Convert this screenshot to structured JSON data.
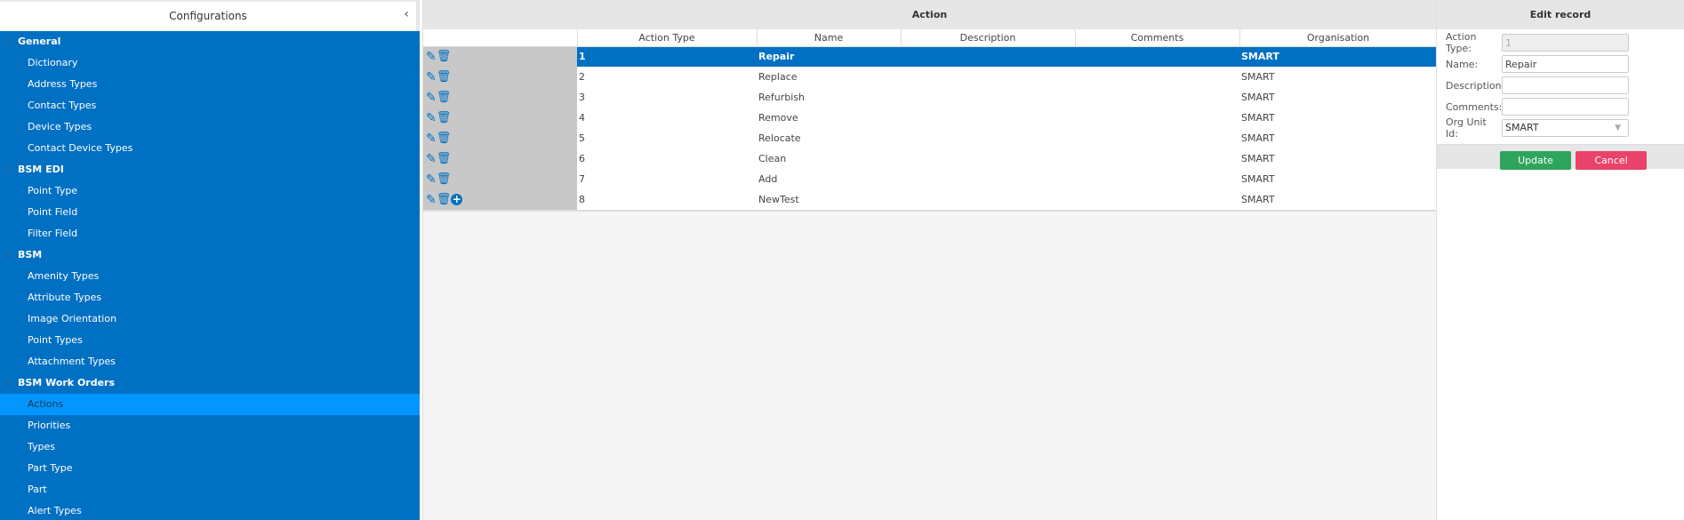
{
  "sidebar": {
    "title": "Configurations",
    "collapse_icon": "chevron-left-icon",
    "groups": [
      {
        "label": "General",
        "items": [
          "Dictionary",
          "Address Types",
          "Contact Types",
          "Device Types",
          "Contact Device Types"
        ]
      },
      {
        "label": "BSM EDI",
        "items": [
          "Point Type",
          "Point Field",
          "Filter Field"
        ]
      },
      {
        "label": "BSM",
        "items": [
          "Amenity Types",
          "Attribute Types",
          "Image Orientation",
          "Point Types",
          "Attachment Types"
        ]
      },
      {
        "label": "BSM Work Orders",
        "items": [
          "Actions",
          "Priorities",
          "Types",
          "Part Type",
          "Part",
          "Alert Types"
        ]
      }
    ],
    "selected": "Actions"
  },
  "colors": {
    "sidebar": "#0070c3",
    "selected_item": "#0496ff",
    "update": "#2ea55c",
    "cancel": "#e9436a"
  },
  "main": {
    "title": "Action",
    "columns": [
      "Action Type",
      "Name",
      "Description",
      "Comments",
      "Organisation"
    ],
    "rows": [
      {
        "type": "1",
        "name": "Repair",
        "description": "",
        "comments": "",
        "org": "SMART",
        "selected": true
      },
      {
        "type": "2",
        "name": "Replace",
        "description": "",
        "comments": "",
        "org": "SMART"
      },
      {
        "type": "3",
        "name": "Refurbish",
        "description": "",
        "comments": "",
        "org": "SMART"
      },
      {
        "type": "4",
        "name": "Remove",
        "description": "",
        "comments": "",
        "org": "SMART"
      },
      {
        "type": "5",
        "name": "Relocate",
        "description": "",
        "comments": "",
        "org": "SMART"
      },
      {
        "type": "6",
        "name": "Clean",
        "description": "",
        "comments": "",
        "org": "SMART"
      },
      {
        "type": "7",
        "name": "Add",
        "description": "",
        "comments": "",
        "org": "SMART"
      },
      {
        "type": "8",
        "name": "NewTest",
        "description": "",
        "comments": "",
        "org": "SMART",
        "add": true
      }
    ]
  },
  "edit": {
    "title": "Edit record",
    "fields": {
      "action_type_label": "Action Type:",
      "action_type": "1",
      "name_label": "Name:",
      "name": "Repair",
      "description_label": "Description:",
      "description": "",
      "comments_label": "Comments:",
      "comments": "",
      "org_label": "Org Unit Id:",
      "org": "SMART"
    },
    "update": "Update",
    "cancel": "Cancel"
  }
}
